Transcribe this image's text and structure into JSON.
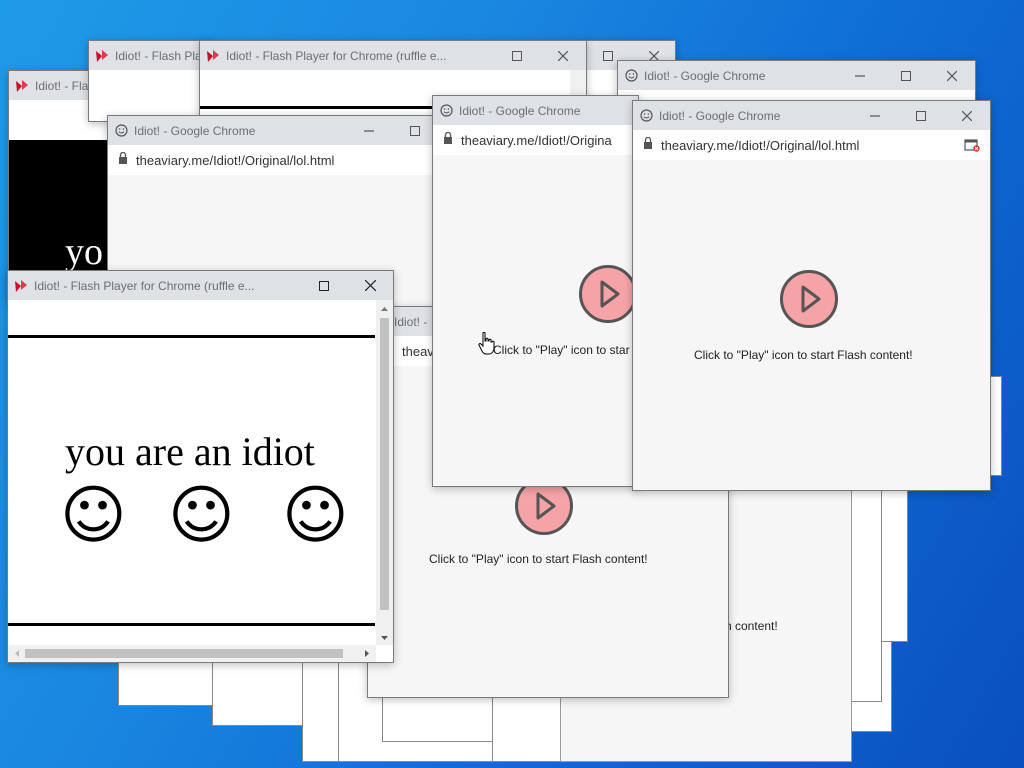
{
  "windows": {
    "flash_title": "Idiot! - Flash Player for Chrome (ruffle e...",
    "flash_title_short": "Idiot! - Flash Player for Chrome",
    "flash_title_cut": "Idiot! - Flash Pla",
    "chrome_title": "Idiot! - Google Chrome",
    "chrome_title_cut": "Idiot! -",
    "url": "theaviary.me/Idiot!/Original/lol.html",
    "url_cut": "theaviary.me/Idiot!/Origina",
    "url_tiny": "theav"
  },
  "flash": {
    "message": "Click to \"Play\" icon to start Flash content!",
    "message_cut": "Click to \"Play\" icon to star",
    "message_tail": "sh content!"
  },
  "idiot": {
    "text": "you are an idiot",
    "text_cut": "yo",
    "smiley": "☺"
  },
  "colors": {
    "play_fill": "#f5a3a6",
    "desktop": "#1a86e0",
    "titlebar": "#dee1e6"
  }
}
